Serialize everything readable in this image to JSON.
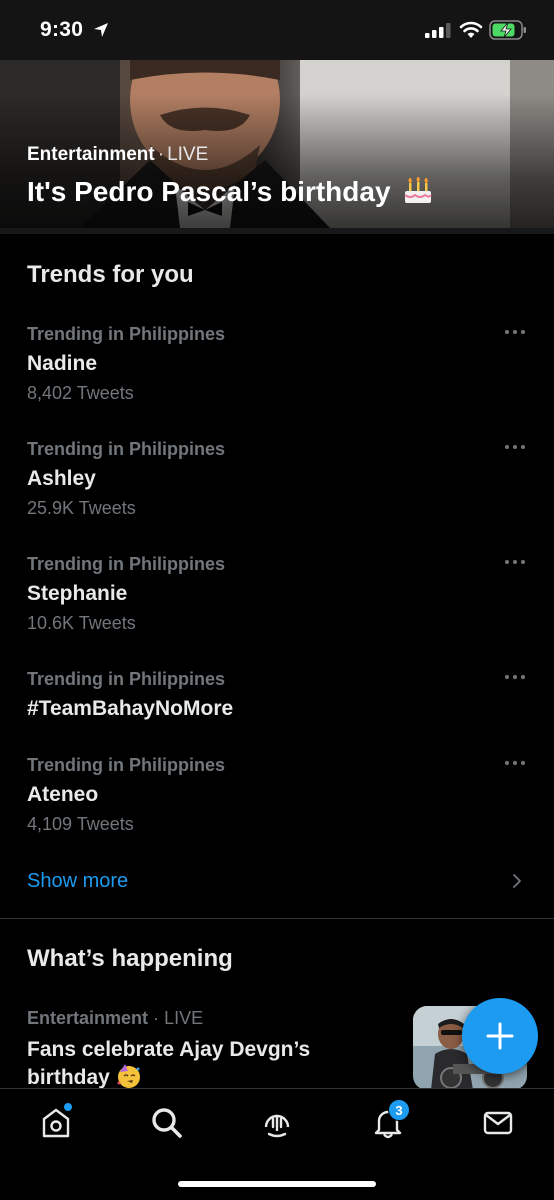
{
  "status_bar": {
    "time": "9:30",
    "icons": [
      "location-arrow-icon",
      "cell-signal-icon",
      "wifi-icon",
      "battery-charging-icon"
    ]
  },
  "hero": {
    "category": "Entertainment",
    "separator": "·",
    "status": "LIVE",
    "title": "It's Pedro Pascal’s birthday",
    "emoji": "birthday-cake-icon"
  },
  "trends": {
    "heading": "Trends for you",
    "items": [
      {
        "context": "Trending in Philippines",
        "name": "Nadine",
        "count": "8,402 Tweets"
      },
      {
        "context": "Trending in Philippines",
        "name": "Ashley",
        "count": "25.9K Tweets"
      },
      {
        "context": "Trending in Philippines",
        "name": "Stephanie",
        "count": "10.6K Tweets"
      },
      {
        "context": "Trending in Philippines",
        "name": "#TeamBahayNoMore",
        "count": ""
      },
      {
        "context": "Trending in Philippines",
        "name": "Ateneo",
        "count": "4,109 Tweets"
      }
    ],
    "show_more": "Show more"
  },
  "whats_happening": {
    "heading": "What’s happening",
    "item": {
      "category": "Entertainment",
      "separator": "·",
      "status": "LIVE",
      "title": "Fans celebrate Ajay Devgn’s birthday",
      "emoji": "partying-face-icon"
    }
  },
  "tabbar": {
    "items": [
      "home-icon",
      "search-icon",
      "spaces-icon",
      "notifications-icon",
      "messages-icon"
    ],
    "notifications_badge": "3"
  },
  "colors": {
    "background": "#000000",
    "accent": "#1d9bf0",
    "text_primary": "#e7e9ea",
    "text_secondary": "#71767b"
  }
}
